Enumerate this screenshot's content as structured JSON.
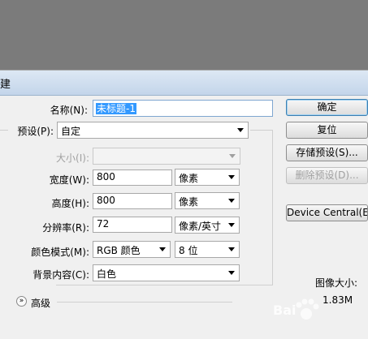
{
  "dialog": {
    "title": "建"
  },
  "fields": {
    "name_label": "名称(N):",
    "name_value": "未标题-1",
    "preset_label": "预设(P):",
    "preset_value": "自定",
    "size_label": "大小(I):",
    "size_value": "",
    "width_label": "宽度(W):",
    "width_value": "800",
    "width_unit": "像素",
    "height_label": "高度(H):",
    "height_value": "800",
    "height_unit": "像素",
    "resolution_label": "分辨率(R):",
    "resolution_value": "72",
    "resolution_unit": "像素/英寸",
    "colormode_label": "颜色模式(M):",
    "colormode_value": "RGB 颜色",
    "bitdepth_value": "8 位",
    "background_label": "背景内容(C):",
    "background_value": "白色"
  },
  "advanced": {
    "label": "高级"
  },
  "buttons": {
    "ok": "确定",
    "reset": "复位",
    "save_preset": "存储预设(S)...",
    "delete_preset": "删除预设(D)...",
    "device_central": "Device Central(E"
  },
  "image_size": {
    "label": "图像大小:",
    "value": "1.83M"
  },
  "watermark": {
    "text": "Bai"
  }
}
